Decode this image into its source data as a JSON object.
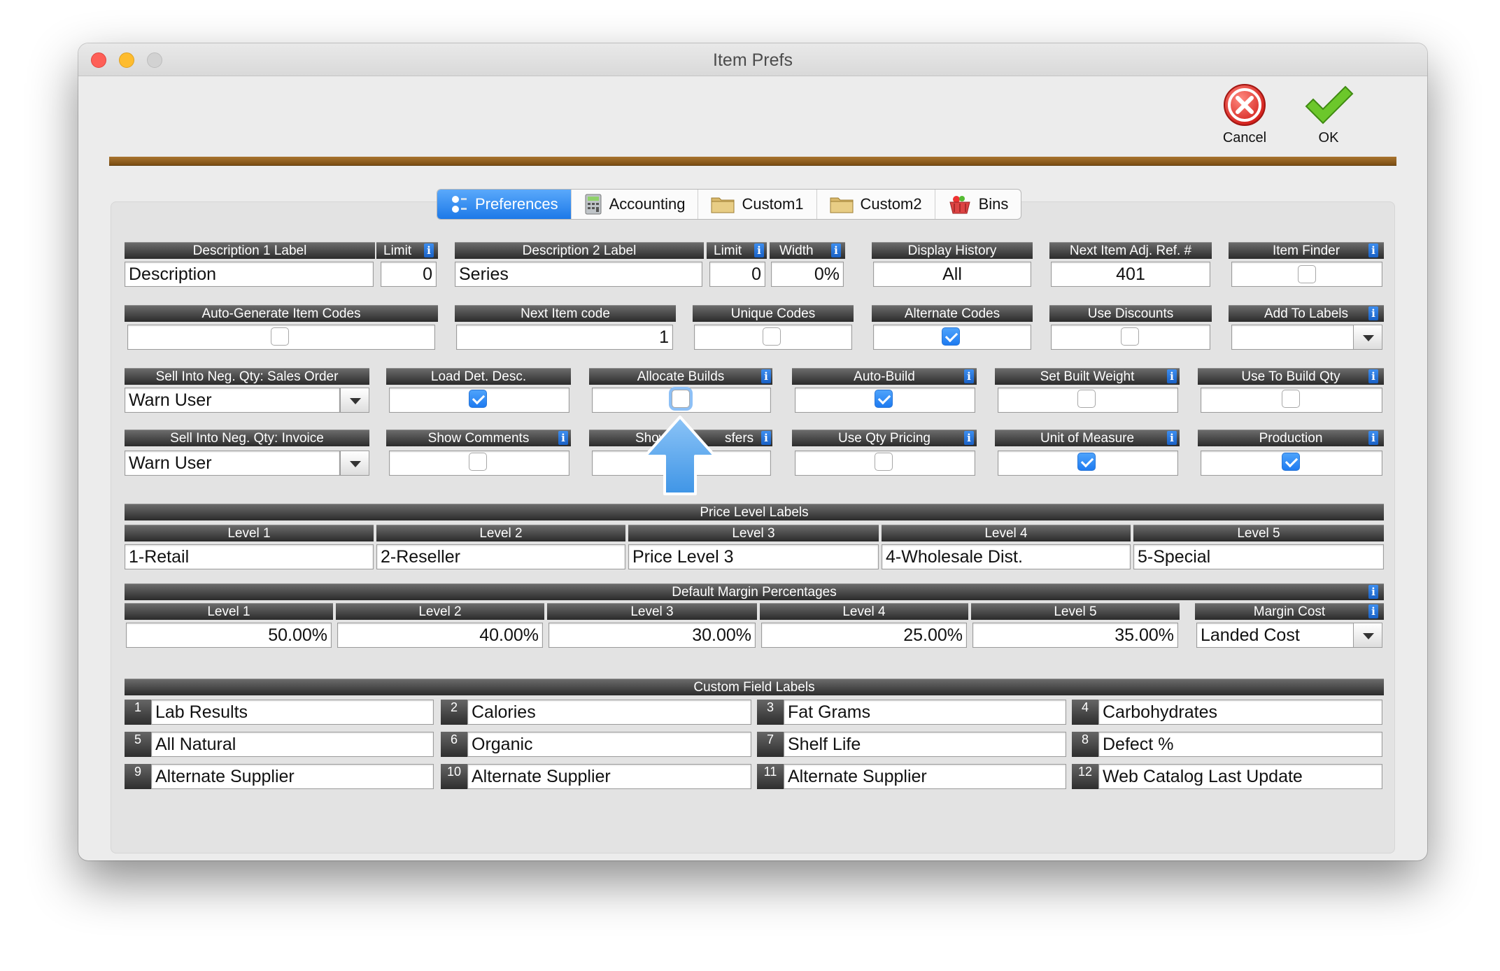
{
  "window": {
    "title": "Item Prefs"
  },
  "toolbar": {
    "cancel_label": "Cancel",
    "ok_label": "OK"
  },
  "tabs": [
    {
      "label": "Preferences",
      "icon": "preferences-icon",
      "active": true
    },
    {
      "label": "Accounting",
      "icon": "calculator-icon",
      "active": false
    },
    {
      "label": "Custom1",
      "icon": "folder-icon",
      "active": false
    },
    {
      "label": "Custom2",
      "icon": "folder-icon",
      "active": false
    },
    {
      "label": "Bins",
      "icon": "basket-icon",
      "active": false
    }
  ],
  "row1": {
    "desc1_label": "Description 1 Label",
    "desc1_value": "Description",
    "limit1_label": "Limit",
    "limit1_value": "0",
    "desc2_label": "Description 2 Label",
    "desc2_value": "Series",
    "limit2_label": "Limit",
    "limit2_value": "0",
    "width_label": "Width",
    "width_value": "0%",
    "display_history_label": "Display History",
    "display_history_value": "All",
    "next_adj_label": "Next Item Adj. Ref. #",
    "next_adj_value": "401",
    "item_finder_label": "Item Finder",
    "item_finder_checked": false
  },
  "row2": {
    "auto_gen_label": "Auto-Generate Item Codes",
    "auto_gen_checked": false,
    "next_code_label": "Next Item code",
    "next_code_value": "1",
    "unique_label": "Unique Codes",
    "unique_checked": false,
    "alternate_label": "Alternate Codes",
    "alternate_checked": true,
    "discounts_label": "Use Discounts",
    "discounts_checked": false,
    "add_labels_label": "Add To Labels",
    "add_labels_value": ""
  },
  "row3": {
    "sell_so_label": "Sell Into Neg. Qty: Sales Order",
    "sell_so_value": "Warn User",
    "load_det_label": "Load Det. Desc.",
    "load_det_checked": true,
    "allocate_label": "Allocate Builds",
    "allocate_checked": false,
    "auto_build_label": "Auto-Build",
    "auto_build_checked": true,
    "built_weight_label": "Set Built Weight",
    "built_weight_checked": false,
    "build_qty_label": "Use To Build Qty",
    "build_qty_checked": false
  },
  "row4": {
    "sell_inv_label": "Sell Into Neg. Qty: Invoice",
    "sell_inv_value": "Warn User",
    "comments_label": "Show Comments",
    "comments_checked": false,
    "transfers_label_left": "Show",
    "transfers_label_right": "sfers",
    "transfers_checked": false,
    "qty_pricing_label": "Use Qty Pricing",
    "qty_pricing_checked": false,
    "uom_label": "Unit of Measure",
    "uom_checked": true,
    "production_label": "Production",
    "production_checked": true
  },
  "price_levels": {
    "title": "Price Level Labels",
    "levels": [
      {
        "label": "Level 1",
        "value": "1-Retail"
      },
      {
        "label": "Level 2",
        "value": "2-Reseller"
      },
      {
        "label": "Level 3",
        "value": "Price Level 3"
      },
      {
        "label": "Level 4",
        "value": "4-Wholesale Dist."
      },
      {
        "label": "Level 5",
        "value": "5-Special"
      }
    ]
  },
  "margins": {
    "title": "Default Margin Percentages",
    "levels": [
      {
        "label": "Level 1",
        "value": "50.00%"
      },
      {
        "label": "Level 2",
        "value": "40.00%"
      },
      {
        "label": "Level 3",
        "value": "30.00%"
      },
      {
        "label": "Level 4",
        "value": "25.00%"
      },
      {
        "label": "Level 5",
        "value": "35.00%"
      }
    ],
    "margin_cost_label": "Margin Cost",
    "margin_cost_value": "Landed Cost"
  },
  "custom_fields": {
    "title": "Custom Field Labels",
    "items": [
      {
        "num": "1",
        "value": "Lab Results"
      },
      {
        "num": "2",
        "value": "Calories"
      },
      {
        "num": "3",
        "value": "Fat Grams"
      },
      {
        "num": "4",
        "value": "Carbohydrates"
      },
      {
        "num": "5",
        "value": "All Natural"
      },
      {
        "num": "6",
        "value": "Organic"
      },
      {
        "num": "7",
        "value": "Shelf Life"
      },
      {
        "num": "8",
        "value": "Defect %"
      },
      {
        "num": "9",
        "value": "Alternate Supplier"
      },
      {
        "num": "10",
        "value": "Alternate Supplier"
      },
      {
        "num": "11",
        "value": "Alternate Supplier"
      },
      {
        "num": "12",
        "value": "Web Catalog Last Update"
      }
    ]
  },
  "info_glyph": "i",
  "colors": {
    "accent": "#1e7bf1",
    "header": "#2b2b2b",
    "divider": "#8a5a1a"
  }
}
